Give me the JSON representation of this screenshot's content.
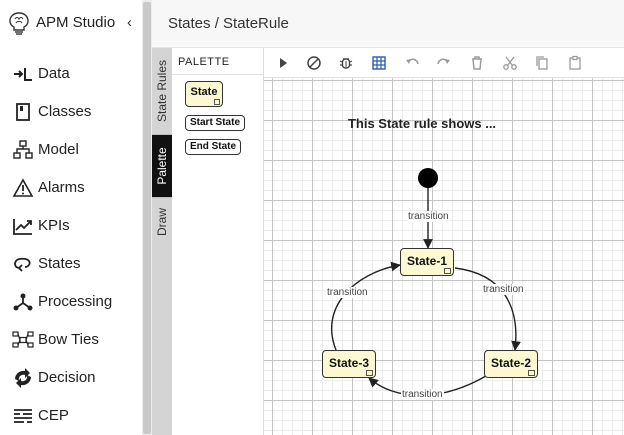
{
  "app": {
    "title": "APM Studio",
    "collapse_glyph": "‹"
  },
  "sidebar": {
    "items": [
      {
        "label": "Data",
        "icon": "data-import-icon"
      },
      {
        "label": "Classes",
        "icon": "classes-icon"
      },
      {
        "label": "Model",
        "icon": "model-hierarchy-icon"
      },
      {
        "label": "Alarms",
        "icon": "warning-triangle-icon"
      },
      {
        "label": "KPIs",
        "icon": "kpi-trend-icon"
      },
      {
        "label": "States",
        "icon": "states-loop-icon"
      },
      {
        "label": "Processing",
        "icon": "processing-icon"
      },
      {
        "label": "Bow Ties",
        "icon": "bow-ties-icon"
      },
      {
        "label": "Decision",
        "icon": "decision-icon"
      },
      {
        "label": "CEP",
        "icon": "cep-icon"
      }
    ]
  },
  "header": {
    "breadcrumb": "States / StateRule"
  },
  "vertical_tabs": [
    {
      "label": "State Rules",
      "active": false
    },
    {
      "label": "Palette",
      "active": true
    },
    {
      "label": "Draw",
      "active": false
    }
  ],
  "palette": {
    "title": "PALETTE",
    "items": {
      "state": "State",
      "start_state": "Start State",
      "end_state": "End State"
    }
  },
  "toolbar": {
    "tools": [
      "play-icon",
      "cancel-icon",
      "debug-icon",
      "grid-icon",
      "undo-icon",
      "redo-icon",
      "delete-icon",
      "cut-icon",
      "copy-icon",
      "paste-icon"
    ]
  },
  "diagram": {
    "title": "This State rule shows ...",
    "states": {
      "state1": "State-1",
      "state2": "State-2",
      "state3": "State-3"
    },
    "transitions": {
      "start_to_1": "transition",
      "s1_to_s2": "transition",
      "s2_to_s3": "transition",
      "s3_to_s1": "transition"
    }
  },
  "colors": {
    "state_fill": "#fbf8d2",
    "active_tab": "#111111",
    "grid_major": "#c4c4c4",
    "grid_minor": "#ececec"
  }
}
